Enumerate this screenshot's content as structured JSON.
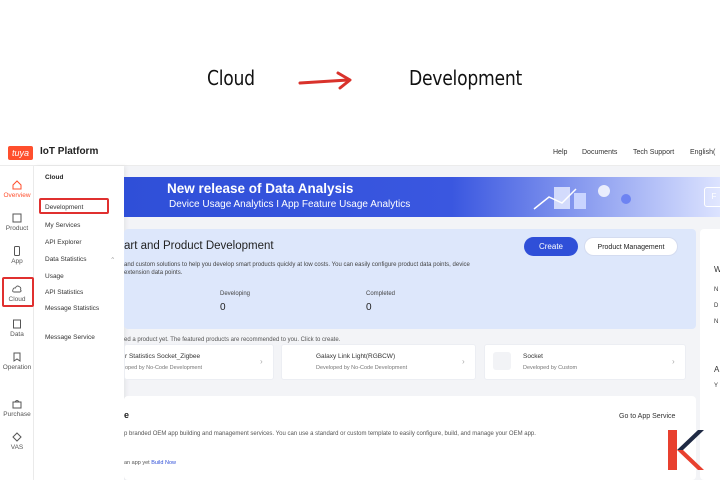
{
  "caption": {
    "from": "Cloud",
    "to": "Development"
  },
  "topbar": {
    "logo": "tuya",
    "title": "IoT Platform",
    "links": [
      "Help",
      "Documents",
      "Tech Support",
      "English("
    ]
  },
  "rail": {
    "items": [
      {
        "label": "Overview",
        "icon": "home-icon"
      },
      {
        "label": "Product",
        "icon": "product-icon"
      },
      {
        "label": "App",
        "icon": "app-icon"
      },
      {
        "label": "Cloud",
        "icon": "cloud-icon"
      },
      {
        "label": "Data",
        "icon": "data-icon"
      },
      {
        "label": "Operation",
        "icon": "operation-icon"
      },
      {
        "label": "Purchase",
        "icon": "purchase-icon"
      },
      {
        "label": "VAS",
        "icon": "vas-icon"
      }
    ]
  },
  "submenu": {
    "header": "Cloud",
    "items": [
      "Development",
      "My Services",
      "API Explorer",
      "Data Statistics",
      "Usage",
      "API Statistics",
      "Message Statistics",
      "Message Service"
    ]
  },
  "banner": {
    "title": "New release of Data Analysis",
    "subtitle": "Device Usage Analytics I App Feature Usage Analytics",
    "button": "F"
  },
  "smart_dev": {
    "title": "art and Product Development",
    "desc_line1": "and custom solutions to help you develop smart products quickly at low costs. You can easily configure product data points, device",
    "desc_line2": "extension data points.",
    "create_label": "Create",
    "manage_label": "Product Management",
    "stats": [
      {
        "label": "Developing",
        "value": "0"
      },
      {
        "label": "Completed",
        "value": "0"
      }
    ]
  },
  "recommend": {
    "text": "ed a product yet. The featured products are recommended to you. Click to create.",
    "products": [
      {
        "name": "r Statistics Socket_Zigbee",
        "sub": "oped by No-Code Development"
      },
      {
        "name": "Galaxy Link Light(RGBCW)",
        "sub": "Developed by No-Code Development"
      },
      {
        "name": "Socket",
        "sub": "Developed by Custom"
      }
    ]
  },
  "app_service": {
    "title": "e",
    "link": "Go to App Service",
    "desc": "p branded OEM app building and management services. You can use a standard or custom template to easily configure, build, and manage your OEM app.",
    "note_prefix": "an app yet",
    "note_link": "Build Now"
  },
  "right_panel": {
    "letters": [
      "W",
      "N",
      "D",
      "N",
      "A",
      "Y"
    ]
  },
  "colors": {
    "accent": "#2f4fd8",
    "highlight": "#e0302f",
    "brand": "#ff4f2d"
  }
}
